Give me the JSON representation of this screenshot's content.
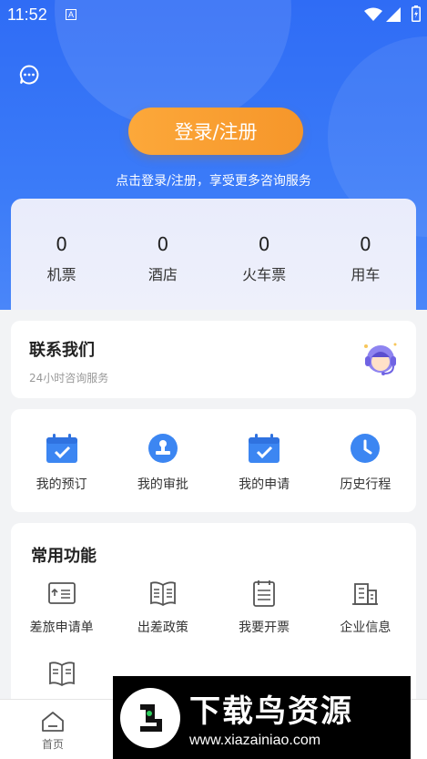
{
  "status": {
    "time": "11:52",
    "a_badge": "A"
  },
  "hero": {
    "login_label": "登录/注册",
    "tip": "点击登录/注册，享受更多咨询服务"
  },
  "stats": [
    {
      "value": "0",
      "label": "机票"
    },
    {
      "value": "0",
      "label": "酒店"
    },
    {
      "value": "0",
      "label": "火车票"
    },
    {
      "value": "0",
      "label": "用车"
    }
  ],
  "contact": {
    "title": "联系我们",
    "subtitle": "24小时咨询服务"
  },
  "quick": [
    {
      "label": "我的预订",
      "icon": "calendar-check-icon"
    },
    {
      "label": "我的审批",
      "icon": "approval-stamp-icon"
    },
    {
      "label": "我的申请",
      "icon": "calendar-check-icon"
    },
    {
      "label": "历史行程",
      "icon": "clock-icon"
    }
  ],
  "functions": {
    "title": "常用功能",
    "items": [
      {
        "label": "差旅申请单",
        "icon": "application-form-icon"
      },
      {
        "label": "出差政策",
        "icon": "policy-book-icon"
      },
      {
        "label": "我要开票",
        "icon": "invoice-icon"
      },
      {
        "label": "企业信息",
        "icon": "building-icon"
      }
    ]
  },
  "tabbar": {
    "home": "首页"
  },
  "watermark": {
    "title": "下载鸟资源",
    "url": "www.xiazainiao.com"
  },
  "colors": {
    "primary": "#2f6cf5",
    "login": "#f99f33",
    "icon_blue": "#3c86f2"
  }
}
